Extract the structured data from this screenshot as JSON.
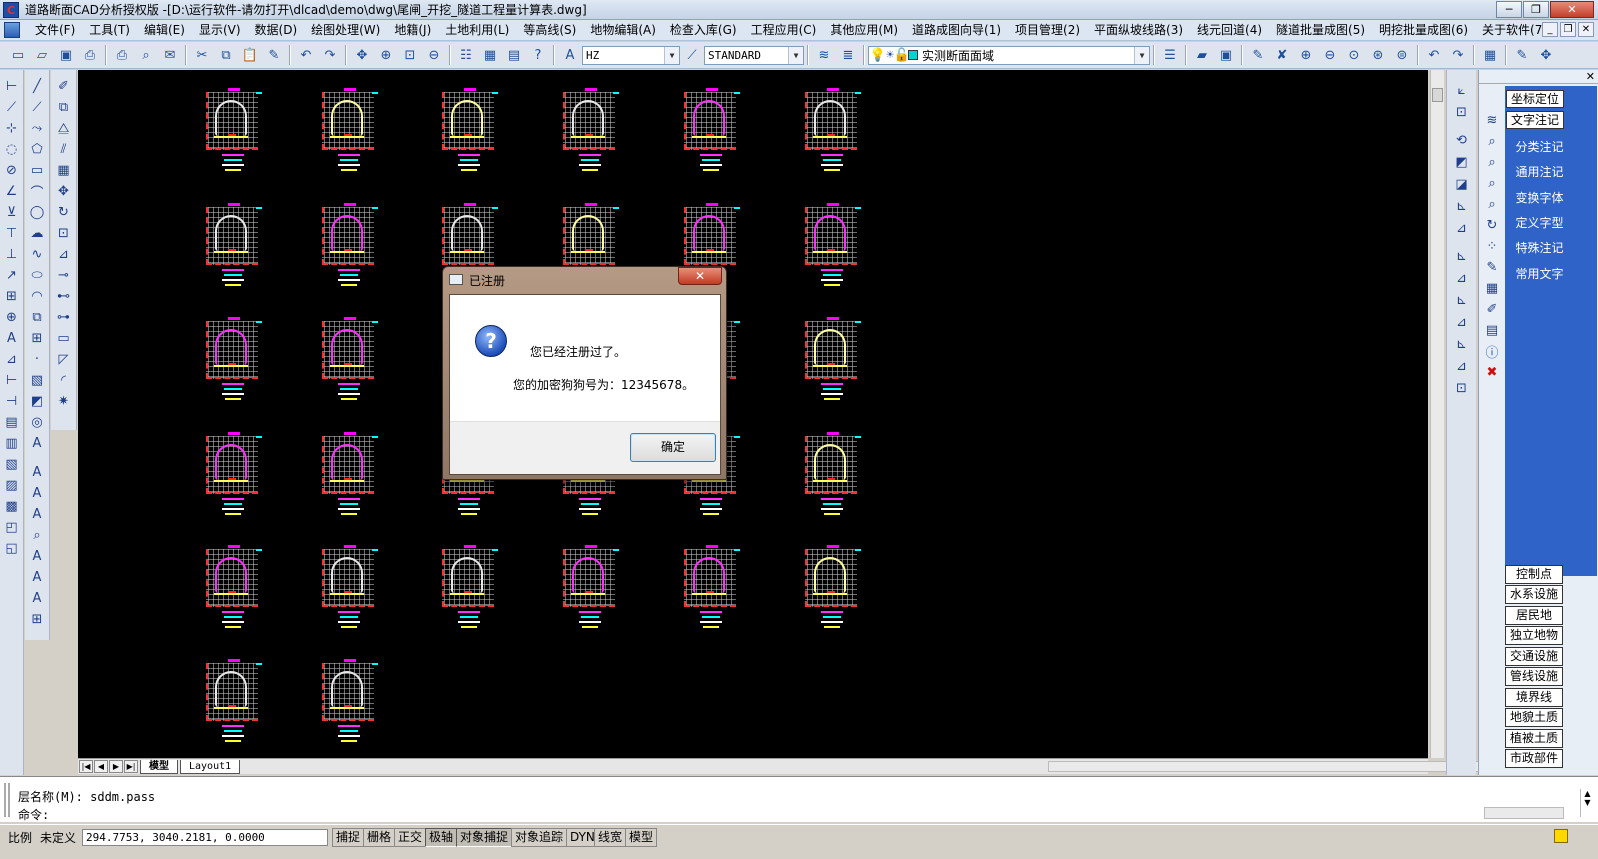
{
  "window": {
    "title": "道路断面CAD分析授权版  -[D:\\运行软件-请勿打开\\dlcad\\demo\\dwg\\尾闸_开挖_隧道工程量计算表.dwg]"
  },
  "menu": [
    "文件(F)",
    "工具(T)",
    "编辑(E)",
    "显示(V)",
    "数据(D)",
    "绘图处理(W)",
    "地籍(J)",
    "土地利用(L)",
    "等高线(S)",
    "地物编辑(A)",
    "检查入库(G)",
    "工程应用(C)",
    "其他应用(M)",
    "道路成图向导(1)",
    "项目管理(2)",
    "平面纵坡线路(3)",
    "线元回道(4)",
    "隧道批量成图(5)",
    "明挖批量成图(6)",
    "关于软件(7)"
  ],
  "toolbar": {
    "text_style": "HZ",
    "dim_style": "STANDARD",
    "layer": "实测断面面域",
    "layer_color": "#00d4d4"
  },
  "sections": {
    "rows": [
      [
        "w",
        "y",
        "y",
        "w",
        "m",
        "w"
      ],
      [
        "w",
        "m",
        "w",
        "y",
        "m",
        "m"
      ],
      [
        "m",
        "m",
        "w",
        "w",
        "w",
        "y"
      ],
      [
        "m",
        "m",
        "w",
        "w",
        "w",
        "y"
      ],
      [
        "m",
        "w",
        "w",
        "m",
        "m",
        "y"
      ],
      [
        "w",
        "w"
      ]
    ]
  },
  "layout_tabs": [
    "模型",
    "Layout1"
  ],
  "right_panel": {
    "top_buttons": [
      "坐标定位",
      "文字注记"
    ],
    "links": [
      "分类注记",
      "通用注记",
      "变换字体",
      "定义字型",
      "特殊注记",
      "常用文字"
    ],
    "bottom_buttons": [
      "控制点",
      "水系设施",
      "居民地",
      "独立地物",
      "交通设施",
      "管线设施",
      "境界线",
      "地貌土质",
      "植被土质",
      "市政部件"
    ]
  },
  "command": {
    "history": "层名称(M): sddm.pass",
    "prompt": "命令:"
  },
  "status": {
    "scale_label": "比例",
    "scale_value": "未定义",
    "coords": "294.7753, 3040.2181, 0.0000",
    "modes": [
      {
        "label": "捕捉",
        "on": false
      },
      {
        "label": "栅格",
        "on": false
      },
      {
        "label": "正交",
        "on": false
      },
      {
        "label": "极轴",
        "on": true
      },
      {
        "label": "对象捕捉",
        "on": true
      },
      {
        "label": "对象追踪",
        "on": false
      },
      {
        "label": "DYN",
        "on": false
      },
      {
        "label": "线宽",
        "on": false
      },
      {
        "label": "模型",
        "on": false
      }
    ]
  },
  "dialog": {
    "title": "已注册",
    "message_line1": "您已经注册过了。",
    "message_line2": "您的加密狗狗号为：12345678。",
    "ok_label": "确定"
  }
}
